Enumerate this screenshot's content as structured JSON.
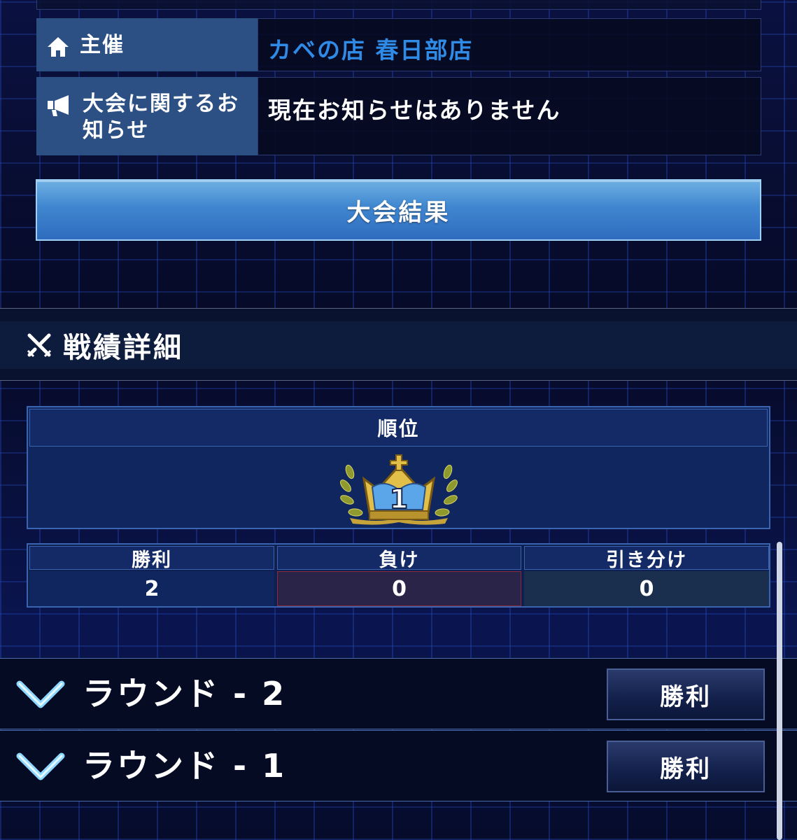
{
  "info": {
    "organizer_label": "主催",
    "organizer_value": "カベの店 春日部店",
    "notice_label": "大会に関するお知らせ",
    "notice_value": "現在お知らせはありません"
  },
  "result_button_label": "大会結果",
  "section": {
    "title": "戦績詳細",
    "icon": "swords-icon"
  },
  "rank": {
    "header": "順位",
    "value": "1",
    "icon": "crown-laurel-icon"
  },
  "stats": [
    {
      "label": "勝利",
      "value": "2",
      "color": "#10265e"
    },
    {
      "label": "負け",
      "value": "0",
      "color": "#2a2548"
    },
    {
      "label": "引き分け",
      "value": "0",
      "color": "#1a2e4e"
    }
  ],
  "rounds": [
    {
      "label": "ラウンド - 2",
      "result": "勝利"
    },
    {
      "label": "ラウンド - 1",
      "result": "勝利"
    }
  ],
  "colors": {
    "accent_link": "#2f8be6",
    "label_panel": "#2c4f84",
    "button_blue": "#3f86cf"
  }
}
